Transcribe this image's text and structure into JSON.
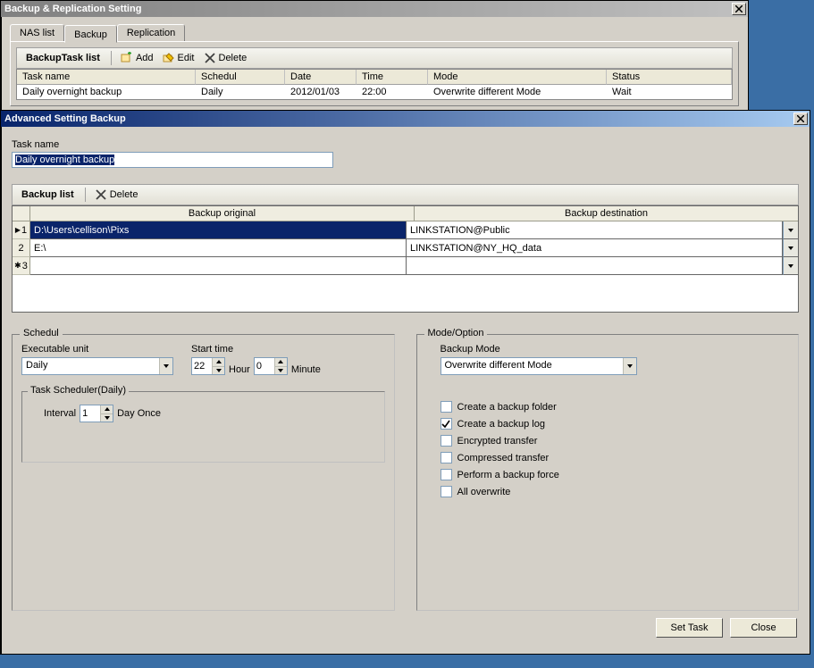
{
  "window1": {
    "title": "Backup & Replication Setting",
    "tabs": [
      "NAS list",
      "Backup",
      "Replication"
    ],
    "active_tab": 1,
    "toolbar": {
      "title": "BackupTask list",
      "add": "Add",
      "edit": "Edit",
      "delete": "Delete"
    },
    "grid": {
      "headers": {
        "task": "Task name",
        "sched": "Schedul",
        "date": "Date",
        "time": "Time",
        "mode": "Mode",
        "status": "Status"
      },
      "row": {
        "task": "Daily overnight backup",
        "sched": "Daily",
        "date": "2012/01/03",
        "time": "22:00",
        "mode": "Overwrite different Mode",
        "status": "Wait"
      }
    }
  },
  "window2": {
    "title": "Advanced Setting Backup",
    "task_name_label": "Task name",
    "task_name_value": "Daily overnight backup",
    "toolbar": {
      "title": "Backup list",
      "delete": "Delete"
    },
    "backup_grid": {
      "col_orig": "Backup original",
      "col_dest": "Backup destination",
      "rows": [
        {
          "num": "1",
          "orig": "D:\\Users\\cellison\\Pixs",
          "dest": "LINKSTATION@Public"
        },
        {
          "num": "2",
          "orig": "E:\\",
          "dest": "LINKSTATION@NY_HQ_data"
        },
        {
          "num": "3",
          "orig": "",
          "dest": ""
        }
      ],
      "marker_new": "✱",
      "marker_cur": "▶"
    },
    "schedul": {
      "legend": "Schedul",
      "exec_unit_label": "Executable unit",
      "exec_unit_value": "Daily",
      "start_time_label": "Start time",
      "hour_value": "22",
      "hour_label": "Hour",
      "minute_value": "0",
      "minute_label": "Minute",
      "task_sched_legend": "Task Scheduler(Daily)",
      "interval_label": "Interval",
      "interval_value": "1",
      "day_once": "Day Once"
    },
    "mode": {
      "legend": "Mode/Option",
      "backup_mode_label": "Backup Mode",
      "backup_mode_value": "Overwrite different Mode",
      "opts": {
        "folder": "Create a backup folder",
        "log": "Create a backup log",
        "encrypted": "Encrypted transfer",
        "compressed": "Compressed transfer",
        "force": "Perform a backup force",
        "all": "All overwrite"
      },
      "checked": {
        "folder": false,
        "log": true,
        "encrypted": false,
        "compressed": false,
        "force": false,
        "all": false
      }
    },
    "buttons": {
      "set_task": "Set Task",
      "close": "Close"
    }
  }
}
